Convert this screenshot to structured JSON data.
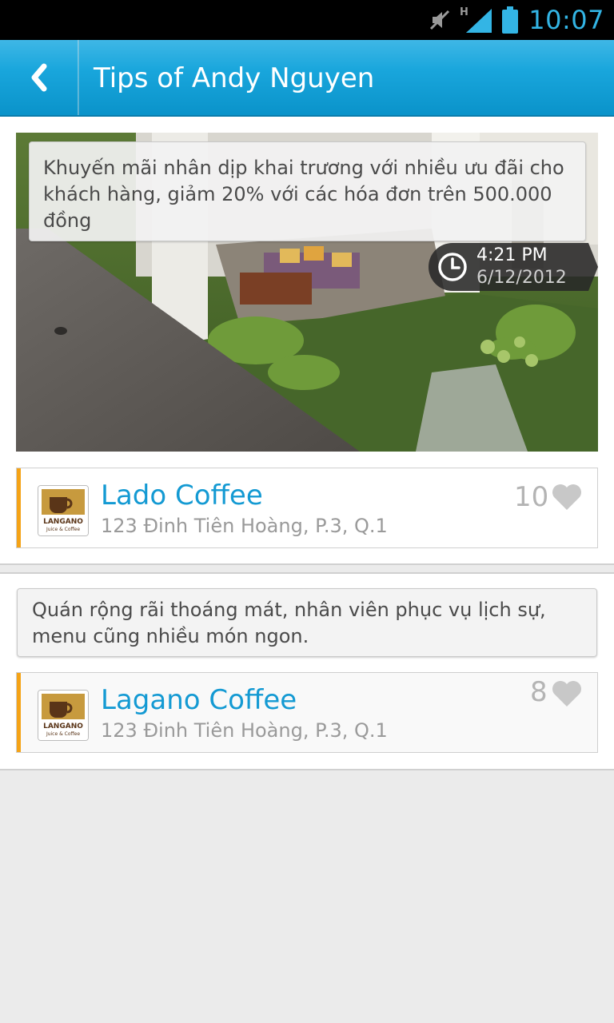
{
  "status_bar": {
    "time": "10:07",
    "icons": [
      "mute-icon",
      "hspa-icon",
      "signal-icon",
      "battery-icon"
    ],
    "network_label": "H",
    "accent_color": "#33b5e5"
  },
  "action_bar": {
    "back_icon": "chevron-left-icon",
    "title": "Tips of Andy Nguyen",
    "color": "#19a6dc"
  },
  "tips": [
    {
      "text": "Khuyến mãi nhân dịp khai trương với nhiều ưu đãi cho khách hàng, giảm 20% với các hóa đơn trên 500.000 đồng",
      "time": "4:21 PM",
      "date": "6/12/2012",
      "has_photo": true,
      "venue": {
        "name": "Lado Coffee",
        "address": "123 Đinh Tiên Hoàng, P.3, Q.1",
        "likes": "10",
        "logo_text": "LANGANO",
        "logo_subtext": "Juice & Coffee"
      }
    },
    {
      "text": "Quán rộng rãi thoáng mát, nhân viên phục vụ lịch sự, menu cũng nhiều món ngon.",
      "venue": {
        "name": "Lagano Coffee",
        "address": "123 Đinh Tiên Hoàng, P.3, Q.1",
        "likes": "8",
        "logo_text": "LANGANO",
        "logo_subtext": "Juice & Coffee"
      }
    }
  ],
  "colors": {
    "venue_name": "#149ad3",
    "accent_bar": "#f5a316",
    "like": "#b4b4b4"
  }
}
